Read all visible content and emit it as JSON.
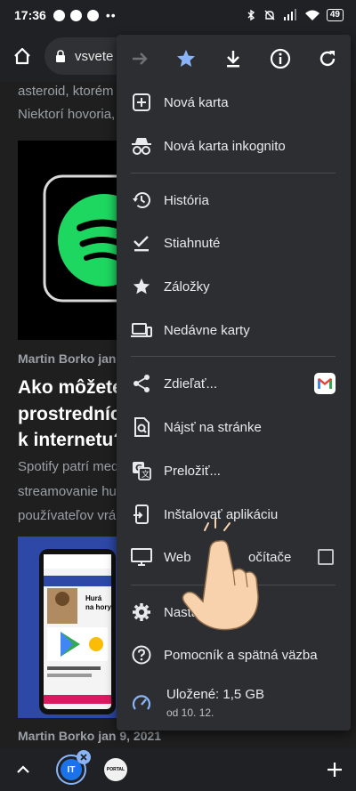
{
  "status": {
    "time": "17:36",
    "dots": "••",
    "battery": "49"
  },
  "address": {
    "url": "vsvete"
  },
  "page": {
    "line1": "asteroid, ktorém",
    "line2": "Niektorí hovoria,",
    "author1": "Martin Borko  jan",
    "heading1": "Ako môžete",
    "heading2": "prostrednícť",
    "heading3": "k internetu?",
    "text1": "Spotify patrí med",
    "text2": "streamovanie hu",
    "text3": "používateľov vrá",
    "author2": "Martin Borko  jan 9, 2021",
    "phone_text1": "Hurá",
    "phone_text2": "na hory"
  },
  "menu": {
    "items": [
      {
        "label": "Nová karta",
        "icon": "new-tab-icon"
      },
      {
        "label": "Nová karta inkognito",
        "icon": "incognito-icon"
      },
      {
        "label": "História",
        "icon": "history-icon"
      },
      {
        "label": "Stiahnuté",
        "icon": "downloads-icon"
      },
      {
        "label": "Záložky",
        "icon": "bookmarks-icon"
      },
      {
        "label": "Nedávne karty",
        "icon": "recent-tabs-icon"
      },
      {
        "label": "Zdieľať...",
        "icon": "share-icon"
      },
      {
        "label": "Nájsť na stránke",
        "icon": "find-in-page-icon"
      },
      {
        "label": "Preložiť...",
        "icon": "translate-icon"
      },
      {
        "label": "Inštalovať aplikáciu",
        "icon": "install-app-icon"
      },
      {
        "label": "Web",
        "label_end": "očítače",
        "icon": "desktop-icon"
      },
      {
        "label": "Nasta",
        "label_end": "a",
        "icon": "settings-icon"
      },
      {
        "label": "Pomocník a spätná väzba",
        "icon": "help-icon"
      }
    ],
    "saved_title": "Uložené: 1,5 GB",
    "saved_subtitle": "od 10. 12."
  },
  "colors": {
    "accent": "#8ab4f8",
    "menu_bg": "#2d2e31",
    "spotify_green": "#1ed760",
    "gmail_red": "#ea4335",
    "tab_counter": "#1a73e8",
    "hand": "#f8d2ad"
  },
  "bottom": {
    "tab_label": "IT",
    "tab2_label": "PORTAL"
  }
}
